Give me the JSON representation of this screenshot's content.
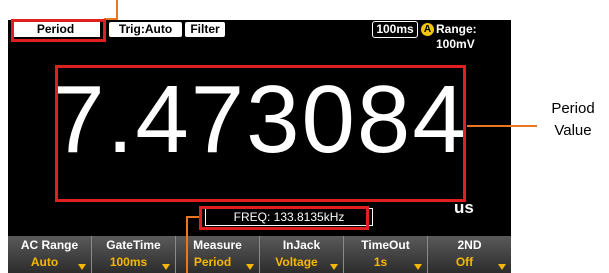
{
  "status_bar": {
    "mode": "Period",
    "trigger": "Trig:Auto",
    "filter": "Filter",
    "rate": "100ms",
    "auto_icon": "A",
    "range": "Range: 100mV"
  },
  "display": {
    "main_value": "7.473084",
    "unit": "us",
    "second_display": "FREQ: 133.8135kHz"
  },
  "softkeys": [
    {
      "label": "AC Range",
      "value": "Auto"
    },
    {
      "label": "GateTime",
      "value": "100ms"
    },
    {
      "label": "Measure",
      "value": "Period"
    },
    {
      "label": "InJack",
      "value": "Voltage"
    },
    {
      "label": "TimeOut",
      "value": "1s"
    },
    {
      "label": "2ND",
      "value": "Off"
    }
  ],
  "annotation": {
    "label_line1": "Period",
    "label_line2": "Value"
  },
  "colors": {
    "annotation_box": "#e02020",
    "annotation_line": "#e87722",
    "softkey_value": "#f5b800",
    "auto_icon": "#f1c40f"
  }
}
